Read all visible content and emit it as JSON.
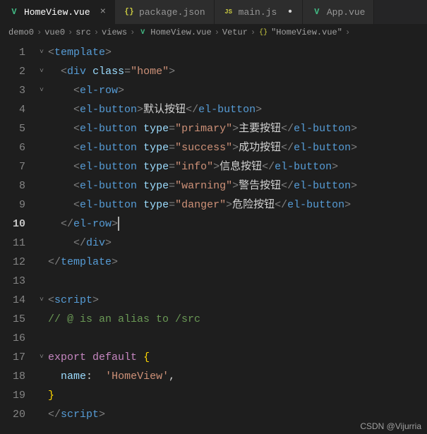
{
  "tabs": [
    {
      "label": "HomeView.vue",
      "iconType": "vue",
      "active": true,
      "dirty": false
    },
    {
      "label": "package.json",
      "iconType": "json",
      "active": false,
      "dirty": false
    },
    {
      "label": "main.js",
      "iconType": "js",
      "active": false,
      "dirty": true
    },
    {
      "label": "App.vue",
      "iconType": "vue",
      "active": false,
      "dirty": false
    }
  ],
  "breadcrumb": {
    "items": [
      {
        "label": "demo0",
        "icon": ""
      },
      {
        "label": "vue0",
        "icon": ""
      },
      {
        "label": "src",
        "icon": ""
      },
      {
        "label": "views",
        "icon": ""
      },
      {
        "label": "HomeView.vue",
        "icon": "vue"
      },
      {
        "label": "Vetur",
        "icon": ""
      },
      {
        "label": "\"HomeView.vue\"",
        "icon": "braces"
      }
    ],
    "sep": "›"
  },
  "currentLine": 10,
  "lines": [
    {
      "n": 1,
      "fold": "˅",
      "html": "<span class='p'>&lt;</span><span class='tag'>template</span><span class='p'>&gt;</span>"
    },
    {
      "n": 2,
      "fold": "˅",
      "html": "  <span class='p'>&lt;</span><span class='tag'>div</span> <span class='attr'>class</span><span class='p'>=</span><span class='str'>\"home\"</span><span class='p'>&gt;</span>"
    },
    {
      "n": 3,
      "fold": "˅",
      "html": "    <span class='p'>&lt;</span><span class='tag'>el-row</span><span class='p'>&gt;</span>"
    },
    {
      "n": 4,
      "fold": "",
      "html": "    <span class='p'>&lt;</span><span class='tag'>el-button</span><span class='p'>&gt;</span><span class='txt'>默认按钮</span><span class='p'>&lt;/</span><span class='tag'>el-button</span><span class='p'>&gt;</span>"
    },
    {
      "n": 5,
      "fold": "",
      "html": "    <span class='p'>&lt;</span><span class='tag'>el-button</span> <span class='attr'>type</span><span class='p'>=</span><span class='str'>\"primary\"</span><span class='p'>&gt;</span><span class='txt'>主要按钮</span><span class='p'>&lt;/</span><span class='tag'>el-button</span><span class='p'>&gt;</span>"
    },
    {
      "n": 6,
      "fold": "",
      "html": "    <span class='p'>&lt;</span><span class='tag'>el-button</span> <span class='attr'>type</span><span class='p'>=</span><span class='str'>\"success\"</span><span class='p'>&gt;</span><span class='txt'>成功按钮</span><span class='p'>&lt;/</span><span class='tag'>el-button</span><span class='p'>&gt;</span>"
    },
    {
      "n": 7,
      "fold": "",
      "html": "    <span class='p'>&lt;</span><span class='tag'>el-button</span> <span class='attr'>type</span><span class='p'>=</span><span class='str'>\"info\"</span><span class='p'>&gt;</span><span class='txt'>信息按钮</span><span class='p'>&lt;/</span><span class='tag'>el-button</span><span class='p'>&gt;</span>"
    },
    {
      "n": 8,
      "fold": "",
      "html": "    <span class='p'>&lt;</span><span class='tag'>el-button</span> <span class='attr'>type</span><span class='p'>=</span><span class='str'>\"warning\"</span><span class='p'>&gt;</span><span class='txt'>警告按钮</span><span class='p'>&lt;/</span><span class='tag'>el-button</span><span class='p'>&gt;</span>"
    },
    {
      "n": 9,
      "fold": "",
      "html": "    <span class='p'>&lt;</span><span class='tag'>el-button</span> <span class='attr'>type</span><span class='p'>=</span><span class='str'>\"danger\"</span><span class='p'>&gt;</span><span class='txt'>危险按钮</span><span class='p'>&lt;/</span><span class='tag'>el-button</span><span class='p'>&gt;</span>"
    },
    {
      "n": 10,
      "fold": "",
      "html": "  <span class='p'>&lt;/</span><span class='tag'>el-row</span><span class='p'>&gt;</span><span class='cursor'></span>"
    },
    {
      "n": 11,
      "fold": "",
      "html": "    <span class='p'>&lt;/</span><span class='tag'>div</span><span class='p'>&gt;</span>"
    },
    {
      "n": 12,
      "fold": "",
      "html": "<span class='p'>&lt;/</span><span class='tag'>template</span><span class='p'>&gt;</span>"
    },
    {
      "n": 13,
      "fold": "",
      "html": ""
    },
    {
      "n": 14,
      "fold": "˅",
      "html": "<span class='p'>&lt;</span><span class='tag'>script</span><span class='p'>&gt;</span>"
    },
    {
      "n": 15,
      "fold": "",
      "html": "<span class='comment'>// @ is an alias to /src</span>"
    },
    {
      "n": 16,
      "fold": "",
      "html": ""
    },
    {
      "n": 17,
      "fold": "˅",
      "html": "<span class='kw-purple'>export</span> <span class='kw-purple'>default</span> <span class='brace'>{</span>"
    },
    {
      "n": 18,
      "fold": "",
      "html": "  <span class='prop'>name</span><span class='txt'>:</span>  <span class='str'>'HomeView'</span><span class='txt'>,</span>"
    },
    {
      "n": 19,
      "fold": "",
      "html": "<span class='brace'>}</span>"
    },
    {
      "n": 20,
      "fold": "",
      "html": "<span class='p'>&lt;/</span><span class='tag'>script</span><span class='p'>&gt;</span>"
    }
  ],
  "watermark": "CSDN @Vijurria"
}
